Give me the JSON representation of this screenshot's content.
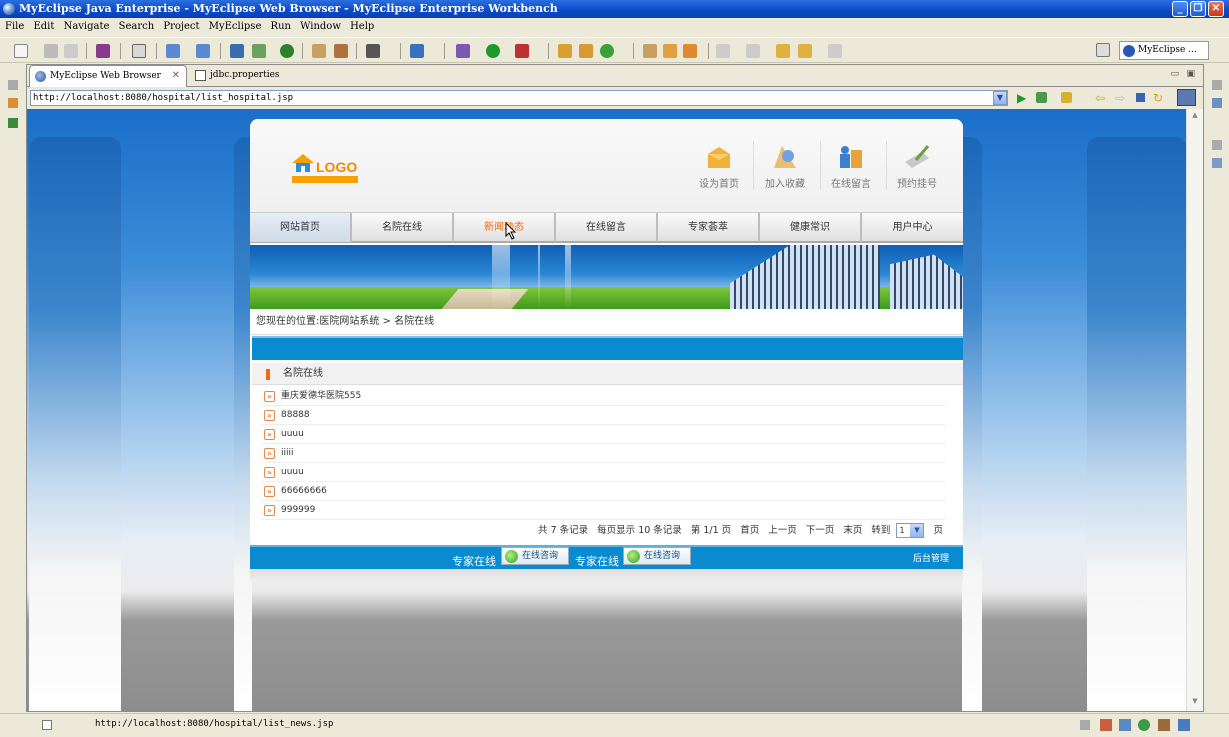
{
  "window": {
    "title": "MyEclipse Java Enterprise - MyEclipse Web Browser - MyEclipse Enterprise Workbench",
    "minimize_glyph": "_",
    "maximize_glyph": "❐",
    "close_glyph": "✕"
  },
  "menubar": {
    "items": [
      "File",
      "Edit",
      "Navigate",
      "Search",
      "Project",
      "MyEclipse",
      "Run",
      "Window",
      "Help"
    ]
  },
  "toolbar": {
    "perspective_label": "MyEclipse ..."
  },
  "editor": {
    "tabs": [
      {
        "label": "MyEclipse Web Browser",
        "close": "✕",
        "active": true,
        "icon": "globe-icon"
      },
      {
        "label": "jdbc.properties",
        "active": false,
        "icon": "properties-file-icon"
      }
    ],
    "url": "http://localhost:8080/hospital/list_hospital.jsp",
    "url_dropdown": "▼"
  },
  "site": {
    "logo_text": "LOGO",
    "header_links": [
      {
        "label": "设为首页",
        "icon": "set-home-icon",
        "color": "#f2b23a"
      },
      {
        "label": "加入收藏",
        "icon": "bookmark-icon",
        "color": "#e8c070"
      },
      {
        "label": "在线留言",
        "icon": "message-icon",
        "color": "#3b7fd0"
      },
      {
        "label": "预约挂号",
        "icon": "appointment-icon",
        "color": "#c9c9c9"
      }
    ],
    "nav": [
      "网站首页",
      "名院在线",
      "新闻动态",
      "在线留言",
      "专家荟萃",
      "健康常识",
      "用户中心"
    ],
    "breadcrumb": "您现在的位置:医院网站系统 > 名院在线",
    "section_title": "名院在线",
    "list": [
      {
        "text": "重庆爱德华医院555",
        "arrow": "»"
      },
      {
        "text": "88888",
        "arrow": "»"
      },
      {
        "text": "uuuu",
        "arrow": "»"
      },
      {
        "text": "iiiii",
        "arrow": "»"
      },
      {
        "text": "uuuu",
        "arrow": "»"
      },
      {
        "text": "66666666",
        "arrow": "»"
      },
      {
        "text": "999999",
        "arrow": "»"
      }
    ],
    "pager": {
      "total": "共 7 条记录",
      "per_page": "每页显示 10 条记录",
      "page_info": "第 1/1 页",
      "first": "首页",
      "prev": "上一页",
      "next": "下一页",
      "last": "末页",
      "goto": "转到",
      "goto_value": "1",
      "goto_dropdown": "▼",
      "page_suffix": "页"
    },
    "footer": {
      "expert_label_1": "专家在线",
      "consult_1": "在线咨询",
      "expert_label_2": "专家在线",
      "consult_2": "在线咨询",
      "admin": "后台管理"
    }
  },
  "status": {
    "text": "http://localhost:8080/hospital/list_news.jsp"
  },
  "colors": {
    "accent_orange": "#f26a10",
    "site_blue": "#0a8bd0",
    "xp_title_blue": "#0a49c8"
  }
}
